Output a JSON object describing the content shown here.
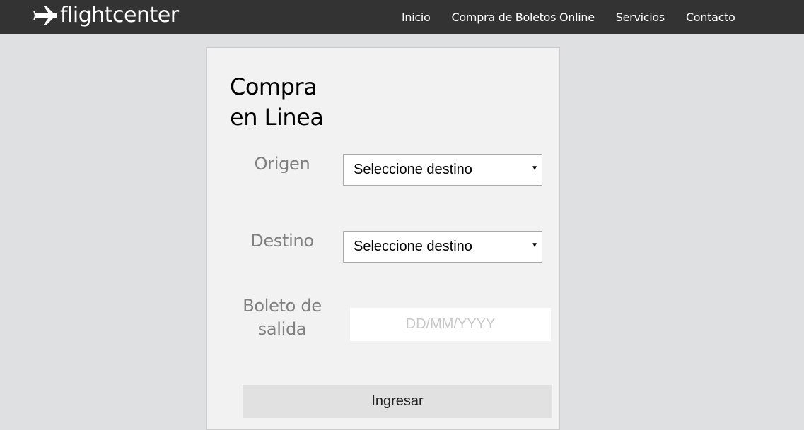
{
  "brand": {
    "name": "flightcenter",
    "icon": "airplane-icon"
  },
  "nav": {
    "items": [
      {
        "label": "Inicio"
      },
      {
        "label": "Compra de Boletos Online"
      },
      {
        "label": "Servicios"
      },
      {
        "label": "Contacto"
      }
    ]
  },
  "form": {
    "title_line1": "Compra",
    "title_line2": "en Linea",
    "origin": {
      "label": "Origen",
      "value": "Seleccione destino"
    },
    "destination": {
      "label": "Destino",
      "value": "Seleccione destino"
    },
    "departure": {
      "label_line1": "Boleto de",
      "label_line2": "salida",
      "placeholder": "DD/MM/YYYY"
    },
    "submit_label": "Ingresar"
  },
  "colors": {
    "navbar_bg": "#333333",
    "page_bg": "#dee0e1",
    "card_bg": "#f2f2f2",
    "label_gray": "#808080"
  }
}
